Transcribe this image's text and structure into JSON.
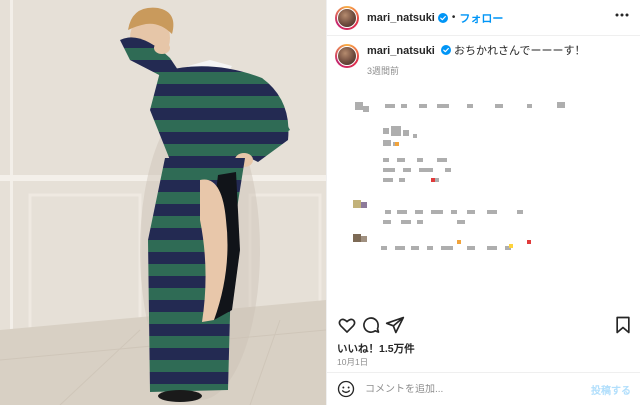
{
  "post": {
    "username": "mari_natsuki",
    "follow_label": "フォロー",
    "separator": "•",
    "caption_user": "mari_natsuki",
    "caption_text": "おちかれさんでーーーす！",
    "caption_time": "3週間前",
    "likes": "いいね！1.5万件",
    "date": "10月1日"
  },
  "comment": {
    "placeholder": "コメントを追加...",
    "post_label": "投稿する"
  },
  "icons": {
    "verified": "verified-badge-icon",
    "more": "more-options-icon",
    "like": "heart-icon",
    "comment": "comment-icon",
    "share": "share-icon",
    "save": "bookmark-icon",
    "emoji": "emoji-icon"
  },
  "colors": {
    "accent": "#0095f6",
    "post_disabled": "#b2dffc",
    "secondary_text": "#8e8e8e",
    "stripe_green": "#2f6b55",
    "stripe_navy": "#232a52"
  }
}
